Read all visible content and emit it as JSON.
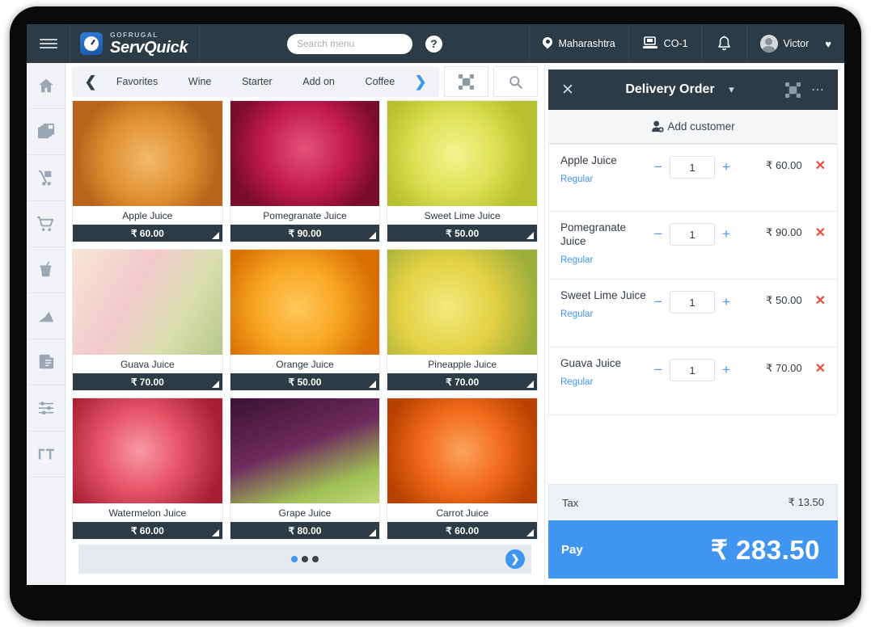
{
  "header": {
    "menu_icon": "hamburger-icon",
    "brand_top": "GOFRUGAL",
    "brand_main": "ServQuick",
    "search_placeholder": "Search menu",
    "search_value": "",
    "help_icon": "question-mark-icon",
    "location_icon": "map-pin-icon",
    "location": "Maharashtra",
    "terminal_icon": "pos-terminal-icon",
    "terminal": "CO-1",
    "bell_icon": "notification-bell-icon",
    "user_icon": "avatar-icon",
    "user": "Victor",
    "caret": "♥"
  },
  "rail": {
    "items": [
      {
        "name": "home",
        "icon": "home-icon"
      },
      {
        "name": "catalogue",
        "icon": "stacked-pages-icon"
      },
      {
        "name": "delivery",
        "icon": "hand-truck-icon"
      },
      {
        "name": "orders",
        "icon": "shopping-cart-icon"
      },
      {
        "name": "beverages",
        "icon": "drink-cup-icon"
      },
      {
        "name": "reports",
        "icon": "bar-chart-icon"
      },
      {
        "name": "bills",
        "icon": "clipboard-icon"
      },
      {
        "name": "settings",
        "icon": "sliders-icon"
      },
      {
        "name": "tables",
        "icon": "table-layout-icon"
      }
    ]
  },
  "categories": {
    "prev_icon": "chevron-left-icon",
    "next_icon": "chevron-right-icon",
    "tabs": [
      "Favorites",
      "Wine",
      "Starter",
      "Add on",
      "Coffee"
    ],
    "expand_icon": "expand-icon",
    "search_icon": "search-icon"
  },
  "products": [
    {
      "name": "Apple Juice",
      "price": "₹ 60.00",
      "c1": "#f0b068",
      "c2": "#d98a2b",
      "c3": "#e8b9a0"
    },
    {
      "name": "Pomegranate Juice",
      "price": "₹ 90.00",
      "c1": "#d6215a",
      "c2": "#8e0f33",
      "c3": "#e3547c"
    },
    {
      "name": "Sweet Lime Juice",
      "price": "₹ 50.00",
      "c1": "#e9ea5c",
      "c2": "#c3cf3a",
      "c3": "#eef3a8"
    },
    {
      "name": "Guava Juice",
      "price": "₹ 70.00",
      "c1": "#f3c9cf",
      "c2": "#cfd9a8",
      "c3": "#f7e6d4"
    },
    {
      "name": "Orange Juice",
      "price": "₹ 50.00",
      "c1": "#f9a825",
      "c2": "#e06c00",
      "c3": "#ffca5c"
    },
    {
      "name": "Pineapple Juice",
      "price": "₹ 70.00",
      "c1": "#f2e45a",
      "c2": "#cbb62c",
      "c3": "#e8f0a0"
    },
    {
      "name": "Watermelon Juice",
      "price": "₹ 60.00",
      "c1": "#e8566a",
      "c2": "#b82438",
      "c3": "#f49aa4"
    },
    {
      "name": "Grape Juice",
      "price": "₹ 80.00",
      "c1": "#6e2a5e",
      "c2": "#3a1233",
      "c3": "#b9cf6a"
    },
    {
      "name": "Carrot Juice",
      "price": "₹ 60.00",
      "c1": "#f26a1b",
      "c2": "#c84700",
      "c3": "#f9a05c"
    }
  ],
  "pagination": {
    "dots": 3,
    "active": 0,
    "next_icon": "chevron-right-circle-icon"
  },
  "order": {
    "close_icon": "close-x-icon",
    "title": "Delivery Order",
    "title_caret_icon": "chevron-down-icon",
    "expand_icon": "expand-icon",
    "more_icon": "more-dots-icon",
    "add_customer_icon": "add-customer-icon",
    "add_customer": "Add customer",
    "minus_icon": "minus-icon",
    "plus_icon": "plus-icon",
    "delete_icon": "close-x-icon",
    "items": [
      {
        "name": "Apple Juice",
        "variant": "Regular",
        "qty": "1",
        "price": "₹ 60.00"
      },
      {
        "name": "Pomegranate Juice",
        "variant": "Regular",
        "qty": "1",
        "price": "₹ 90.00"
      },
      {
        "name": "Sweet Lime Juice",
        "variant": "Regular",
        "qty": "1",
        "price": "₹ 50.00"
      },
      {
        "name": "Guava Juice",
        "variant": "Regular",
        "qty": "1",
        "price": "₹ 70.00"
      }
    ],
    "tax_label": "Tax",
    "tax_value": "₹ 13.50",
    "pay_label": "Pay",
    "pay_amount": "₹ 283.50"
  },
  "colors": {
    "header_dark": "#2c3b45",
    "accent_blue": "#3f95f0",
    "delete_red": "#e74c3c"
  }
}
